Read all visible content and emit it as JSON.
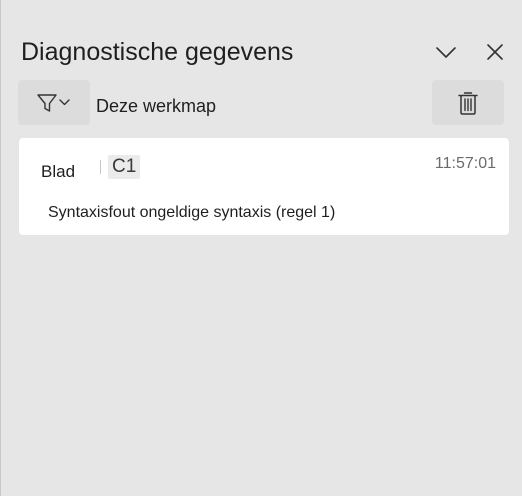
{
  "pane": {
    "title": "Diagnostische gegevens",
    "collapse_icon": "chevron-down-icon",
    "close_icon": "close-icon"
  },
  "toolbar": {
    "filter_icon": "filter-icon",
    "scope_label": "Deze werkmap",
    "delete_icon": "trash-icon"
  },
  "entries": [
    {
      "sheet_label": "Blad",
      "cell": "C1",
      "time": "11:57:01",
      "message": "Syntaxisfout ongeldige syntaxis (regel 1)"
    }
  ]
}
